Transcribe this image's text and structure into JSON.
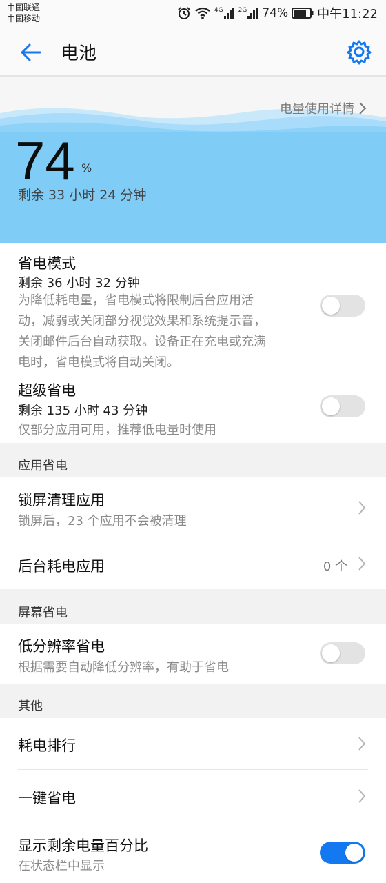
{
  "statusbar": {
    "carrier1": "中国联通",
    "carrier2": "中国移动",
    "net1": "4G",
    "net2": "2G",
    "battery": "74%",
    "time": "中午11:22",
    "icons": [
      "alarm-icon",
      "wifi-icon",
      "signal-icon",
      "battery-icon"
    ]
  },
  "appbar": {
    "title": "电池",
    "back_icon": "arrow-left-icon",
    "settings_icon": "gear-icon"
  },
  "hero": {
    "detail_link": "电量使用详情",
    "percent": "74",
    "percent_sign": "%",
    "remaining": "剩余 33 小时 24 分钟"
  },
  "power_saving": {
    "title": "省电模式",
    "remaining": "剩余 36 小时 32 分钟",
    "desc_lines": [
      "为降低耗电量，省电模式将限制后台应用活",
      "动，减弱或关闭部分视觉效果和系统提示音，",
      "关闭邮件后台自动获取。设备正在充电或充满",
      "电时，省电模式将自动关闭。"
    ],
    "enabled": false
  },
  "ultra_saving": {
    "title": "超级省电",
    "remaining": "剩余 135 小时 43 分钟",
    "desc": "仅部分应用可用，推荐低电量时使用",
    "enabled": false
  },
  "sections": {
    "app": "应用省电",
    "screen": "屏幕省电",
    "other": "其他"
  },
  "lock_clean": {
    "title": "锁屏清理应用",
    "desc": "锁屏后，23 个应用不会被清理"
  },
  "background": {
    "title": "后台耗电应用",
    "count": "0 个"
  },
  "low_res": {
    "title": "低分辨率省电",
    "desc": "根据需要自动降低分辨率，有助于省电",
    "enabled": false
  },
  "ranking": {
    "title": "耗电排行"
  },
  "one_key": {
    "title": "一键省电"
  },
  "show_percent": {
    "title": "显示剩余电量百分比",
    "desc": "在状态栏中显示",
    "enabled": true
  },
  "colors": {
    "accent": "#1478f0",
    "wave_light": "#a8dcfa",
    "wave_dark": "#7cc8f7"
  }
}
